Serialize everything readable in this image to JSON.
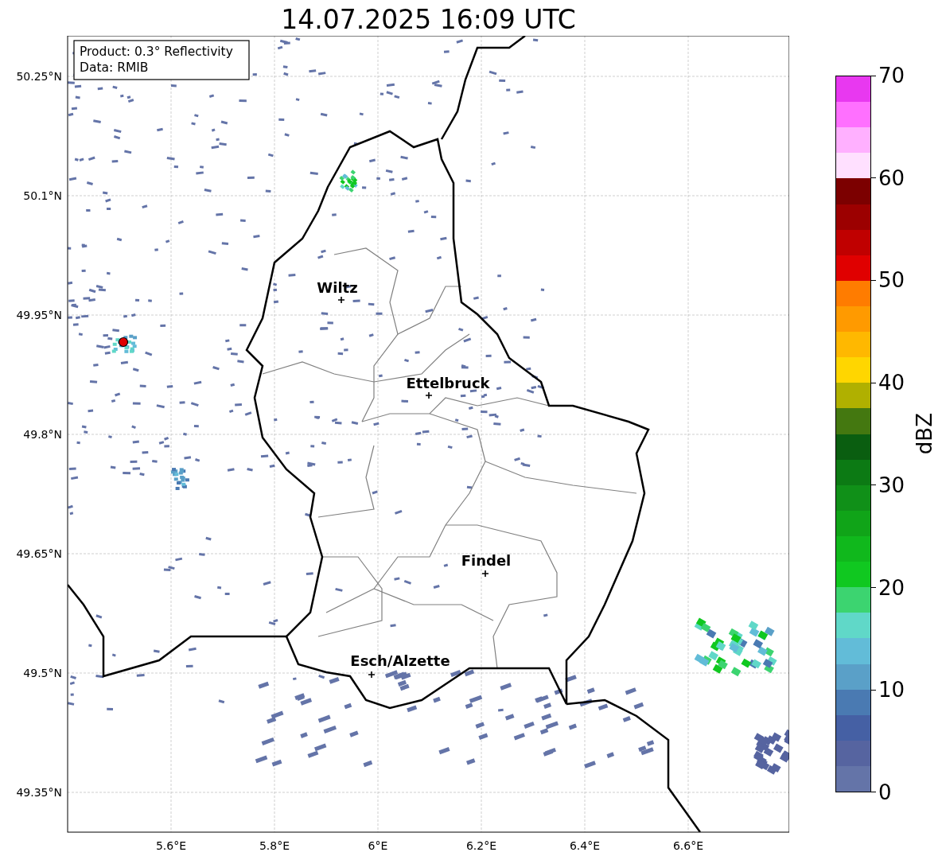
{
  "title": "14.07.2025 16:09 UTC",
  "info_box": [
    "Product: 0.3° Reflectivity",
    "Data: RMIB"
  ],
  "y_ticks": [
    "50.25°N",
    "50.1°N",
    "49.95°N",
    "49.8°N",
    "49.65°N",
    "49.5°N",
    "49.35°N"
  ],
  "x_ticks": [
    "5.6°E",
    "5.8°E",
    "6°E",
    "6.2°E",
    "6.4°E",
    "6.6°E"
  ],
  "cities": [
    {
      "name": "Wiltz"
    },
    {
      "name": "Ettelbruck"
    },
    {
      "name": "Findel"
    },
    {
      "name": "Esch/Alzette"
    }
  ],
  "colorbar": {
    "label": "dBZ",
    "ticks": [
      "70",
      "60",
      "50",
      "40",
      "30",
      "20",
      "10",
      "0"
    ],
    "bins": [
      {
        "color": "#e838f0"
      },
      {
        "color": "#ff70ff"
      },
      {
        "color": "#ffb0ff"
      },
      {
        "color": "#ffe0ff"
      },
      {
        "color": "#7c0000"
      },
      {
        "color": "#9c0000"
      },
      {
        "color": "#c00000"
      },
      {
        "color": "#e00000"
      },
      {
        "color": "#ff7c00"
      },
      {
        "color": "#ff9a00"
      },
      {
        "color": "#ffb800"
      },
      {
        "color": "#ffd600"
      },
      {
        "color": "#b0b000"
      },
      {
        "color": "#447810"
      },
      {
        "color": "#0a5e10"
      },
      {
        "color": "#0c7a14"
      },
      {
        "color": "#109018"
      },
      {
        "color": "#10a418"
      },
      {
        "color": "#10b81c"
      },
      {
        "color": "#10c820"
      },
      {
        "color": "#3cd470"
      },
      {
        "color": "#60d8c8"
      },
      {
        "color": "#62bcd8"
      },
      {
        "color": "#5aa0c8"
      },
      {
        "color": "#4a7ab2"
      },
      {
        "color": "#4560a4"
      },
      {
        "color": "#5664a0"
      },
      {
        "color": "#6474a8"
      }
    ]
  }
}
